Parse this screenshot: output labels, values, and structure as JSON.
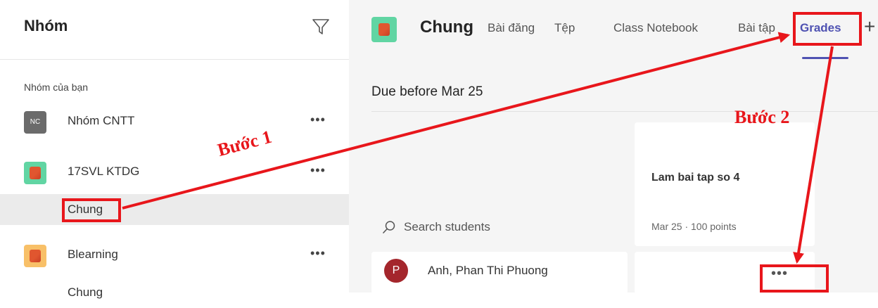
{
  "sidebar": {
    "title": "Nhóm",
    "section_label": "Nhóm của bạn",
    "teams": [
      {
        "initials": "NC",
        "name": "Nhóm CNTT",
        "more": "•••"
      },
      {
        "name": "17SVL KTDG",
        "more": "•••",
        "channel": "Chung"
      },
      {
        "name": "Blearning",
        "more": "•••",
        "channel": "Chung"
      }
    ]
  },
  "header": {
    "channel_title": "Chung",
    "tabs": [
      {
        "label": "Bài đăng"
      },
      {
        "label": "Tệp"
      },
      {
        "label": "Class Notebook"
      },
      {
        "label": "Bài tập"
      },
      {
        "label": "Grades"
      }
    ],
    "add_tab": "+"
  },
  "grades": {
    "due_label": "Due before Mar 25",
    "search_placeholder": "Search students",
    "assignment": {
      "title": "Lam bai tap so 4",
      "meta": "Mar 25 · 100 points"
    },
    "student": {
      "initial": "P",
      "name": "Anh, Phan Thi Phuong"
    },
    "grade_more": "•••"
  },
  "annotations": {
    "step1": "Bước 1",
    "step2": "Bước 2",
    "color": "#e8161b"
  },
  "colors": {
    "accent": "#4f52b2",
    "team_green": "#61d5a3",
    "team_orange": "#f8c068",
    "avatar_red": "#a4262c"
  }
}
